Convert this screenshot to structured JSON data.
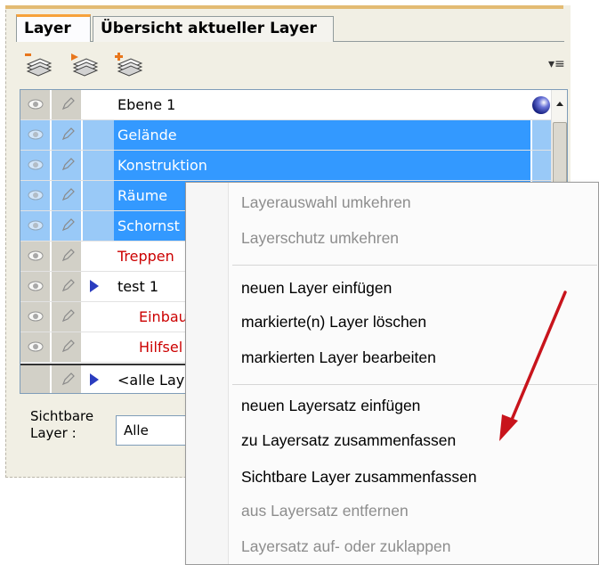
{
  "tabs": [
    {
      "label": "Layer",
      "active": true
    },
    {
      "label": "Übersicht aktueller Layer",
      "active": false
    }
  ],
  "toolbar": {
    "icons": [
      "layer-remove-icon",
      "layer-insert-icon",
      "layer-add-icon"
    ],
    "menu_icon": "▾≡"
  },
  "layers": [
    {
      "name": "Ebene 1",
      "selected": false,
      "color": "normal",
      "expandable": false,
      "indent": false,
      "has_globe": true
    },
    {
      "name": "Gelände",
      "selected": true,
      "color": "normal",
      "expandable": false,
      "indent": false
    },
    {
      "name": "Konstruktion",
      "selected": true,
      "color": "normal",
      "expandable": false,
      "indent": false
    },
    {
      "name": "Räume",
      "selected": true,
      "color": "normal",
      "expandable": false,
      "indent": false
    },
    {
      "name": "Schornst",
      "selected": true,
      "color": "normal",
      "expandable": false,
      "indent": false
    },
    {
      "name": "Treppen",
      "selected": false,
      "color": "red",
      "expandable": false,
      "indent": false
    },
    {
      "name": "test 1",
      "selected": false,
      "color": "normal",
      "expandable": true,
      "indent": false
    },
    {
      "name": "Einbau",
      "selected": false,
      "color": "red",
      "expandable": false,
      "indent": true
    },
    {
      "name": "Hilfsel",
      "selected": false,
      "color": "red",
      "expandable": false,
      "indent": true
    },
    {
      "name": "<alle Lay",
      "selected": false,
      "color": "normal",
      "expandable": true,
      "indent": false
    }
  ],
  "visible_layers": {
    "label_line1": "Sichtbare",
    "label_line2": "Layer :",
    "value": "Alle"
  },
  "context_menu": {
    "groups": [
      [
        {
          "label": "Layerauswahl umkehren",
          "enabled": false
        },
        {
          "label": "Layerschutz umkehren",
          "enabled": false
        }
      ],
      [
        {
          "label": "neuen Layer einfügen",
          "enabled": true
        },
        {
          "label": "markierte(n) Layer löschen",
          "enabled": true
        },
        {
          "label": "markierten Layer bearbeiten",
          "enabled": true
        }
      ],
      [
        {
          "label": "neuen Layersatz einfügen",
          "enabled": true
        },
        {
          "label": "zu Layersatz zusammenfassen",
          "enabled": true
        },
        {
          "label": "Sichtbare Layer zusammenfassen",
          "enabled": true
        },
        {
          "label": "aus Layersatz entfernen",
          "enabled": false
        },
        {
          "label": "Layersatz auf- oder zuklappen",
          "enabled": false
        }
      ]
    ]
  },
  "colors": {
    "selection": "#3399ff",
    "selection_light": "#99c9f7",
    "red_text": "#cc0000",
    "annotation_arrow": "#c8141c",
    "active_tab_accent": "#f7a23b"
  }
}
